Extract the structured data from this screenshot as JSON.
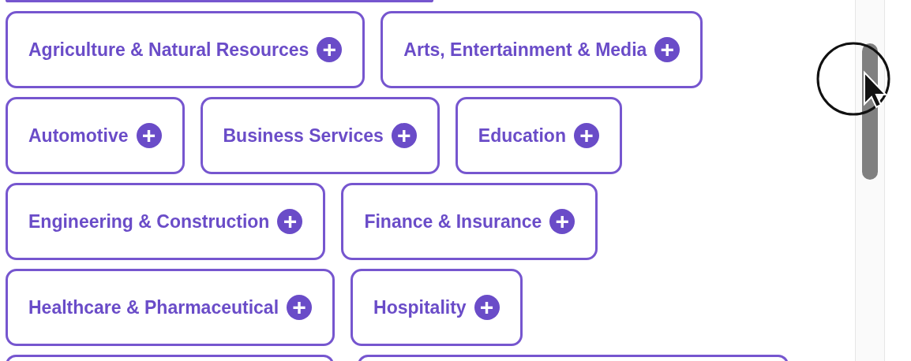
{
  "category_rows": [
    [
      {
        "label": "Agriculture & Natural Resources",
        "icon": "+"
      },
      {
        "label": "Arts, Entertainment & Media",
        "icon": "+"
      }
    ],
    [
      {
        "label": "Automotive",
        "icon": "+"
      },
      {
        "label": "Business Services",
        "icon": "+"
      },
      {
        "label": "Education",
        "icon": "+"
      }
    ],
    [
      {
        "label": "Engineering & Construction",
        "icon": "+"
      },
      {
        "label": "Finance & Insurance",
        "icon": "+"
      }
    ],
    [
      {
        "label": "Healthcare & Pharmaceutical",
        "icon": "+"
      },
      {
        "label": "Hospitality",
        "icon": "+"
      }
    ]
  ]
}
